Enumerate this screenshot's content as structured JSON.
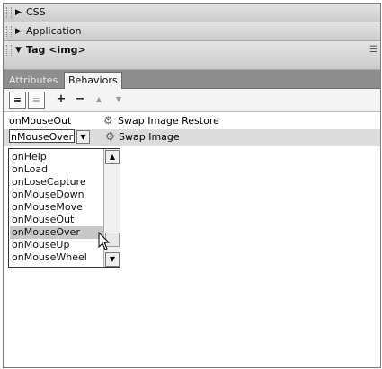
{
  "panels": {
    "css": {
      "label": "CSS"
    },
    "application": {
      "label": "Application"
    },
    "tag": {
      "label": "Tag <img>"
    }
  },
  "tabs": [
    {
      "label": "Attributes"
    },
    {
      "label": "Behaviors"
    }
  ],
  "toolbar": {
    "add": "+",
    "remove": "−",
    "up": "▲",
    "down": "▼"
  },
  "behaviors": [
    {
      "event": "onMouseOut",
      "action": "Swap Image Restore"
    },
    {
      "event": "onMouseOver",
      "action": "Swap Image"
    }
  ],
  "event_select": {
    "value": "nMouseOver",
    "options": [
      "onHelp",
      "onLoad",
      "onLoseCapture",
      "onMouseDown",
      "onMouseMove",
      "onMouseOut",
      "onMouseOver",
      "onMouseUp",
      "onMouseWheel"
    ],
    "highlighted": "onMouseOver"
  }
}
